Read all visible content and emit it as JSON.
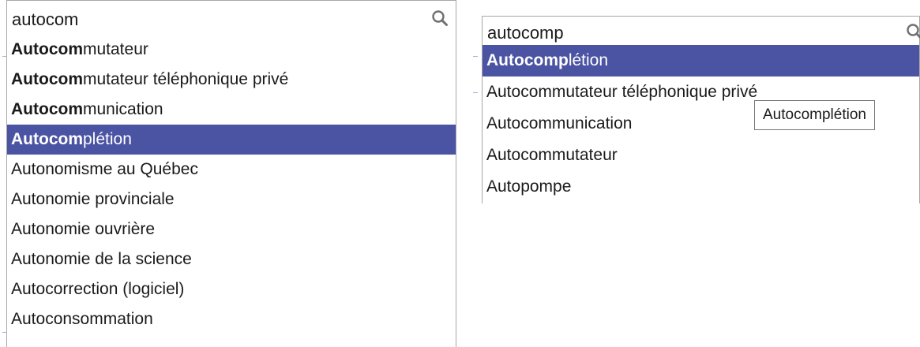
{
  "left": {
    "search": {
      "value": "autocom"
    },
    "results": [
      {
        "match": "Autocom",
        "rest": "mutateur",
        "bold": true,
        "selected": false
      },
      {
        "match": "Autocom",
        "rest": "mutateur téléphonique privé",
        "bold": true,
        "selected": false
      },
      {
        "match": "Autocom",
        "rest": "munication",
        "bold": true,
        "selected": false
      },
      {
        "match": "Autocom",
        "rest": "plétion",
        "bold": true,
        "selected": true
      },
      {
        "match": "",
        "rest": "Autonomisme au Québec",
        "bold": false,
        "selected": false
      },
      {
        "match": "",
        "rest": "Autonomie provinciale",
        "bold": false,
        "selected": false
      },
      {
        "match": "",
        "rest": "Autonomie ouvrière",
        "bold": false,
        "selected": false
      },
      {
        "match": "",
        "rest": "Autonomie de la science",
        "bold": false,
        "selected": false
      },
      {
        "match": "",
        "rest": "Autocorrection (logiciel)",
        "bold": false,
        "selected": false
      },
      {
        "match": "",
        "rest": "Autoconsommation",
        "bold": false,
        "selected": false
      }
    ]
  },
  "right": {
    "search": {
      "value": "autocomp"
    },
    "results": [
      {
        "match": "Autocomp",
        "rest": "létion",
        "bold": true,
        "selected": true
      },
      {
        "match": "",
        "rest": "Autocommutateur téléphonique privé",
        "bold": false,
        "selected": false
      },
      {
        "match": "",
        "rest": "Autocommunication",
        "bold": false,
        "selected": false
      },
      {
        "match": "",
        "rest": "Autocommutateur",
        "bold": false,
        "selected": false
      },
      {
        "match": "",
        "rest": "Autopompe",
        "bold": false,
        "selected": false
      }
    ],
    "tooltip": "Autocomplétion"
  },
  "colors": {
    "selected_bg": "#4b54a3",
    "border": "#a7a7a7"
  }
}
